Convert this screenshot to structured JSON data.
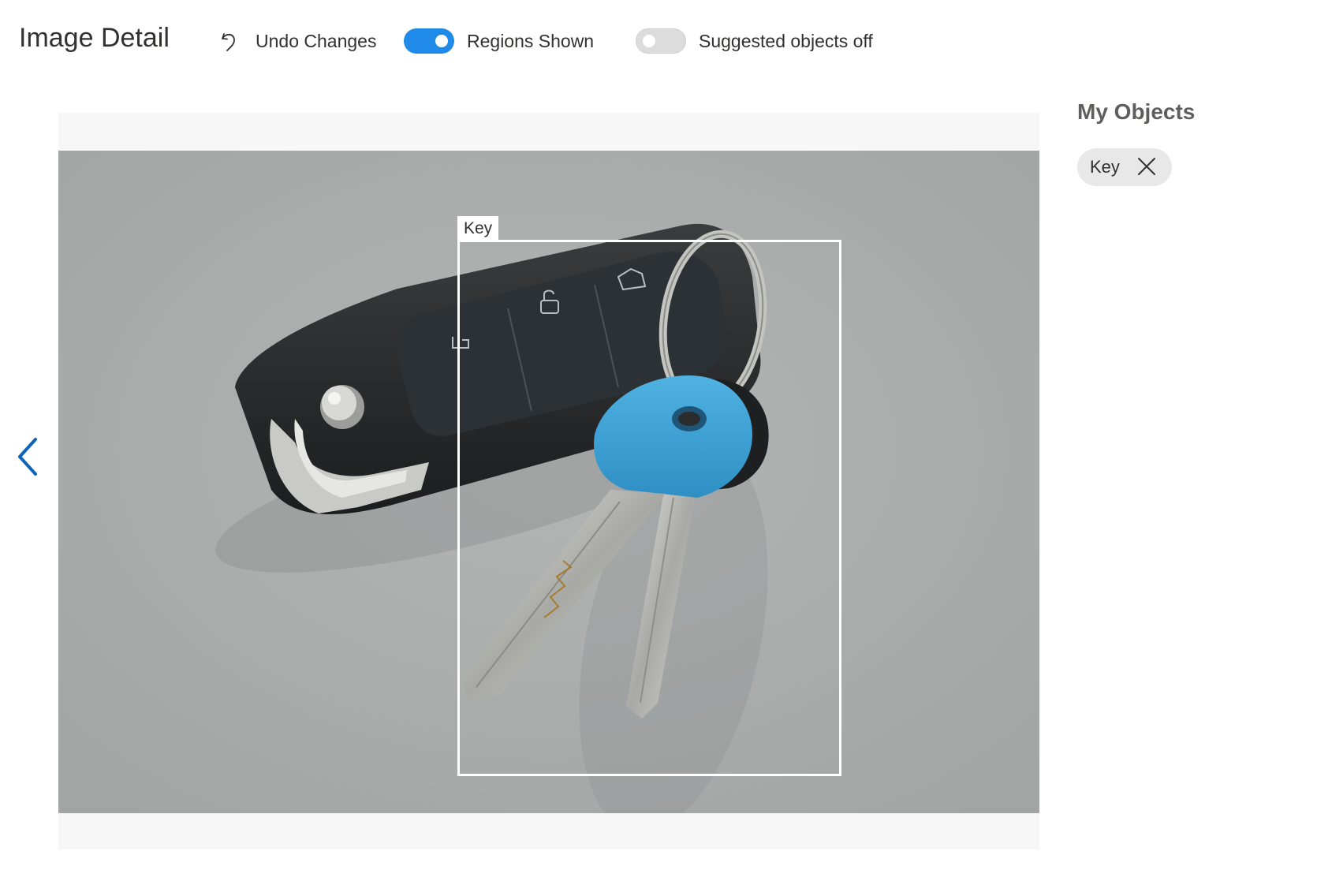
{
  "header": {
    "title": "Image Detail",
    "undo_label": "Undo Changes",
    "undo_icon": "undo-icon",
    "regions_toggle": {
      "label": "Regions Shown",
      "state": "on"
    },
    "suggested_toggle": {
      "label": "Suggested objects off",
      "state": "off"
    }
  },
  "viewer": {
    "prev_icon": "chevron-left-icon",
    "region": {
      "label": "Key"
    }
  },
  "side_panel": {
    "title": "My Objects",
    "tags": [
      {
        "label": "Key",
        "remove_icon": "close-icon"
      }
    ]
  },
  "colors": {
    "accent": "#1f8ae8",
    "nav_arrow": "#0e64b8",
    "key_cap": "#3ea3d6",
    "background": "#a9abab"
  }
}
